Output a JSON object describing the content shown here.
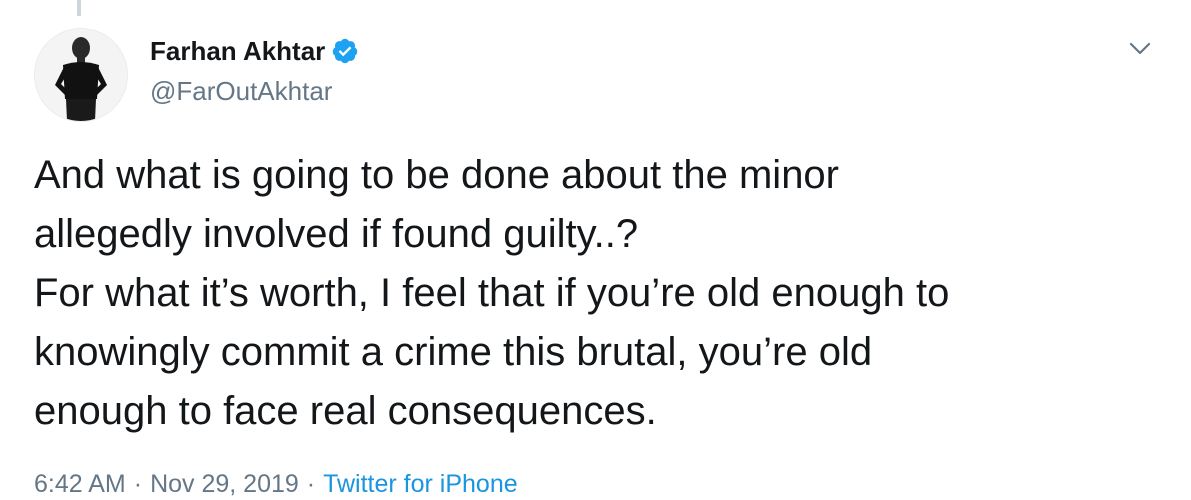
{
  "author": {
    "display_name": "Farhan Akhtar",
    "handle": "@FarOutAkhtar",
    "verified": true,
    "verified_icon": "verified-badge-icon",
    "verified_color": "#1da1f2"
  },
  "tweet": {
    "lines": [
      "And what is going to be done about the minor",
      "allegedly involved if found guilty..?",
      "For what it’s worth, I feel that if you’re old enough to",
      "knowingly commit a crime this brutal, you’re old",
      "enough to face real consequences."
    ]
  },
  "meta": {
    "time": "6:42 AM",
    "separator": "·",
    "date": "Nov 29, 2019",
    "source": "Twitter for iPhone",
    "source_color": "#1b95e0"
  },
  "menu": {
    "icon": "chevron-down-icon"
  }
}
